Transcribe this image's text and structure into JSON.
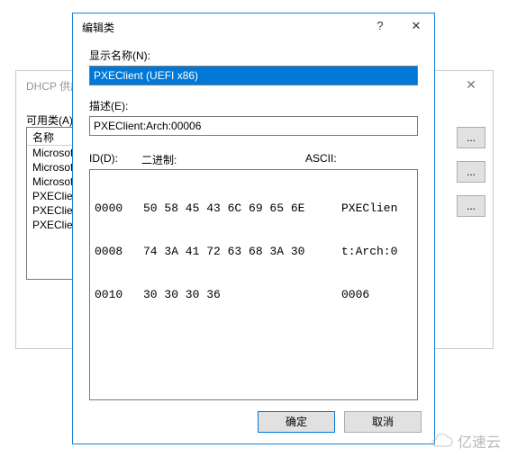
{
  "back": {
    "title": "DHCP 供应",
    "available_label": "可用类(A):",
    "col_header": "名称",
    "items": [
      "Microsoft",
      "Microsoft",
      "Microsoft",
      "PXEClient",
      "PXEClient",
      "PXEClient"
    ],
    "btn_text": "..."
  },
  "front": {
    "title": "编辑类",
    "help_glyph": "?",
    "close_glyph": "✕",
    "display_name_label": "显示名称(N):",
    "display_name_value": "PXEClient (UEFI x86)",
    "desc_label": "描述(E):",
    "desc_value": "PXEClient:Arch:00006",
    "id_label": "ID(D):",
    "binary_label": "二进制:",
    "ascii_label": "ASCII:",
    "hex_rows": [
      {
        "offset": "0000",
        "hex": "50 58 45 43 6C 69 65 6E",
        "ascii": "PXEClien"
      },
      {
        "offset": "0008",
        "hex": "74 3A 41 72 63 68 3A 30",
        "ascii": "t:Arch:0"
      },
      {
        "offset": "0010",
        "hex": "30 30 30 36",
        "ascii": "0006"
      }
    ],
    "ok_label": "确定",
    "cancel_label": "取消"
  },
  "watermark": "亿速云"
}
